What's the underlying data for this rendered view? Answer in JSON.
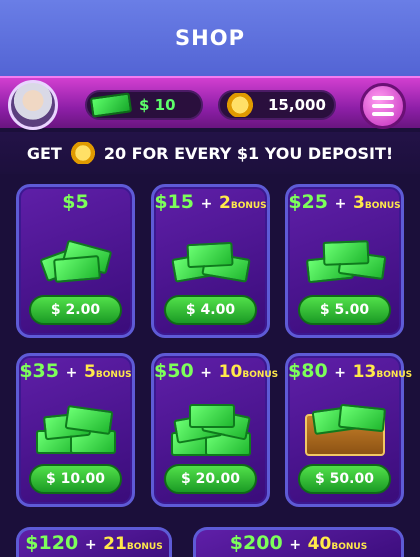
{
  "header": {
    "title": "SHOP"
  },
  "status": {
    "cash_balance": "$ 10",
    "coin_balance": "15,000"
  },
  "promo": {
    "prefix": "GET",
    "suffix": "20 FOR EVERY $1 YOU DEPOSIT!"
  },
  "packages": [
    {
      "amount": "$5",
      "bonus": "",
      "bonus_label": "",
      "price": "$ 2.00"
    },
    {
      "amount": "$15",
      "bonus": "2",
      "bonus_label": "BONUS",
      "price": "$ 4.00"
    },
    {
      "amount": "$25",
      "bonus": "3",
      "bonus_label": "BONUS",
      "price": "$ 5.00"
    },
    {
      "amount": "$35",
      "bonus": "5",
      "bonus_label": "BONUS",
      "price": "$ 10.00"
    },
    {
      "amount": "$50",
      "bonus": "10",
      "bonus_label": "BONUS",
      "price": "$ 20.00"
    },
    {
      "amount": "$80",
      "bonus": "13",
      "bonus_label": "BONUS",
      "price": "$ 50.00"
    },
    {
      "amount": "$120",
      "bonus": "21",
      "bonus_label": "BONUS",
      "price": ""
    },
    {
      "amount": "$200",
      "bonus": "40",
      "bonus_label": "BONUS",
      "price": ""
    }
  ],
  "icons": {
    "avatar": "avatar-icon",
    "cash": "cash-icon",
    "coins": "coins-icon",
    "menu": "menu-icon"
  },
  "colors": {
    "title_bar": "#5e70dc",
    "status_bar": "#b32fc3",
    "card_bg": "#4b168f",
    "buy_button": "#2fbf32",
    "amount_green": "#7dff5a",
    "bonus_yellow": "#ffe94a"
  }
}
